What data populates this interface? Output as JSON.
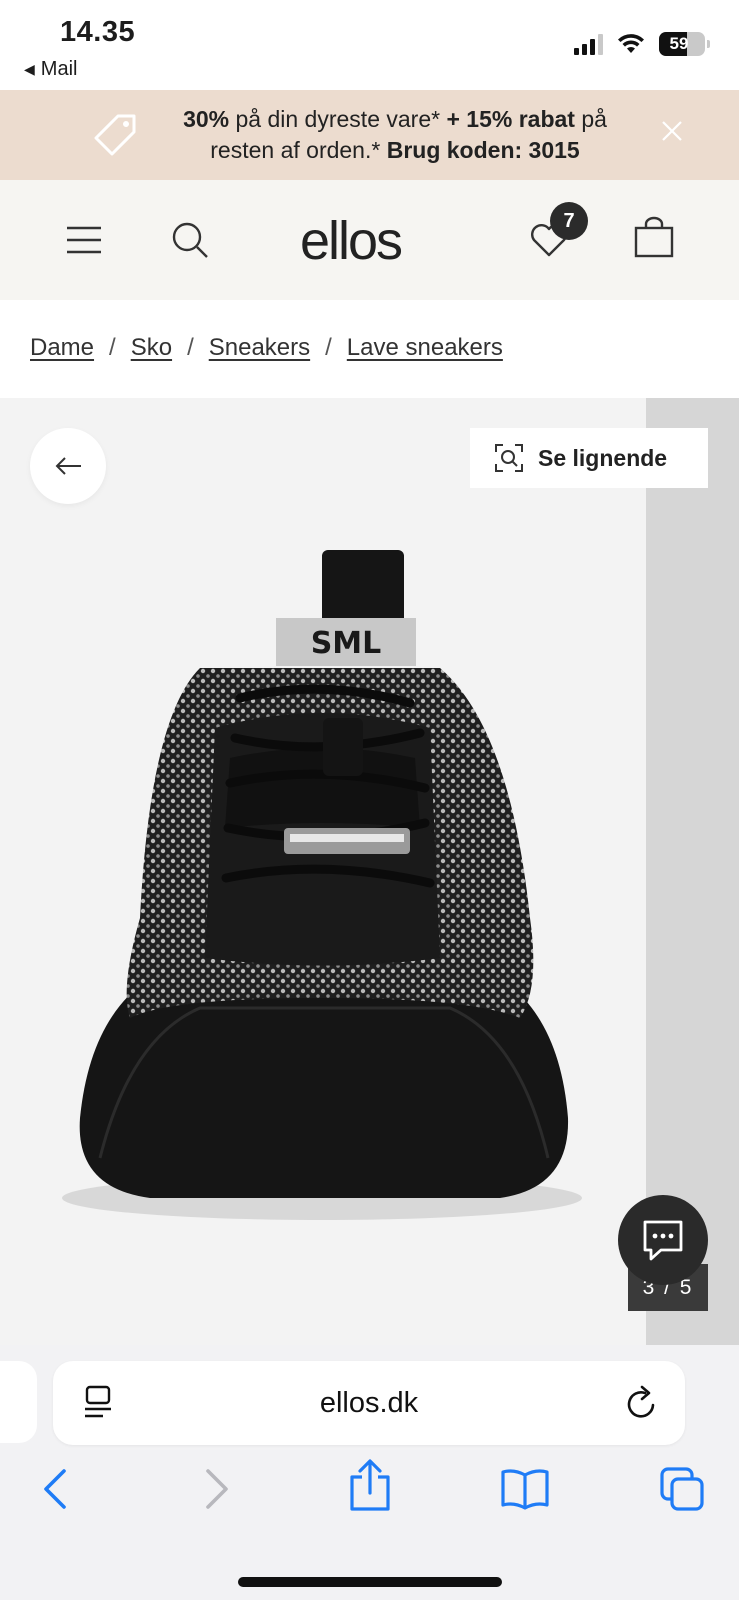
{
  "status_bar": {
    "time": "14.35",
    "back_app": "Mail",
    "battery": "59"
  },
  "promo": {
    "part1_bold": "30%",
    "part1_rest": " på din dyreste vare*",
    "part2_bold": " + 15% rabat",
    "part2_rest": " på resten af orden.*",
    "part3_bold": " Brug koden: 3015"
  },
  "header": {
    "logo": "ellos",
    "wishlist_count": "7"
  },
  "breadcrumb": {
    "items": [
      "Dame",
      "Sko",
      "Sneakers",
      "Lave sneakers"
    ],
    "separator": "/"
  },
  "gallery": {
    "similar_label": "Se lignende",
    "counter": "3 / 5",
    "current": 3,
    "total": 5
  },
  "browser": {
    "url": "ellos.dk"
  },
  "colors": {
    "promo_bg": "#ecdccf",
    "header_bg": "#f6f5f2",
    "ios_blue": "#1f7cf6",
    "dark": "#2a2a2a"
  }
}
